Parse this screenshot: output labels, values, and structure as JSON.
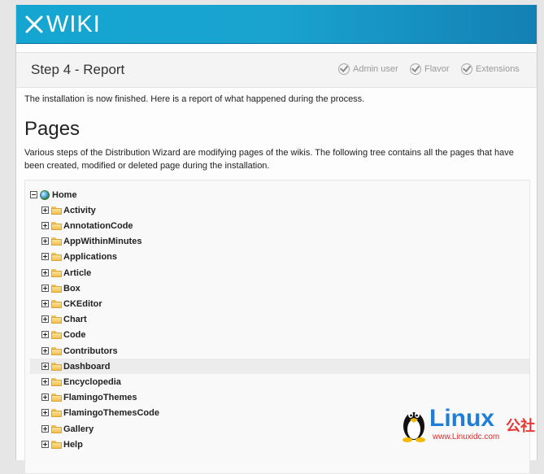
{
  "header": {
    "logo_text": "WIKI",
    "logo_icon": "xwiki-x-icon"
  },
  "wizard": {
    "step_title": "Step 4 - Report",
    "steps": [
      {
        "label": "Admin user",
        "icon": "check-circle-icon"
      },
      {
        "label": "Flavor",
        "icon": "check-circle-icon"
      },
      {
        "label": "Extensions",
        "icon": "check-circle-icon"
      }
    ]
  },
  "report": {
    "intro": "The installation is now finished. Here is a report of what happened during the process.",
    "pages_heading": "Pages",
    "pages_description": "Various steps of the Distribution Wizard are modifying pages of the wikis. The following tree contains all the pages that have been created, modified or deleted page during the installation."
  },
  "tree": {
    "root": {
      "label": "Home",
      "icon": "globe-icon",
      "expanded": true
    },
    "items": [
      {
        "label": "Activity",
        "icon": "folder-icon"
      },
      {
        "label": "AnnotationCode",
        "icon": "folder-icon"
      },
      {
        "label": "AppWithinMinutes",
        "icon": "folder-icon"
      },
      {
        "label": "Applications",
        "icon": "folder-icon"
      },
      {
        "label": "Article",
        "icon": "folder-icon"
      },
      {
        "label": "Box",
        "icon": "folder-icon"
      },
      {
        "label": "CKEditor",
        "icon": "folder-icon"
      },
      {
        "label": "Chart",
        "icon": "folder-icon"
      },
      {
        "label": "Code",
        "icon": "folder-icon"
      },
      {
        "label": "Contributors",
        "icon": "folder-icon"
      },
      {
        "label": "Dashboard",
        "icon": "folder-icon"
      },
      {
        "label": "Encyclopedia",
        "icon": "folder-icon"
      },
      {
        "label": "FlamingoThemes",
        "icon": "folder-icon"
      },
      {
        "label": "FlamingoThemesCode",
        "icon": "folder-icon"
      },
      {
        "label": "Gallery",
        "icon": "folder-icon"
      },
      {
        "label": "Help",
        "icon": "folder-icon"
      }
    ],
    "highlighted_item": "Dashboard"
  },
  "watermark": {
    "text": "Linux",
    "cn_text": "公社",
    "url": "www.Linuxidc.com",
    "icon": "tux-penguin-icon"
  }
}
